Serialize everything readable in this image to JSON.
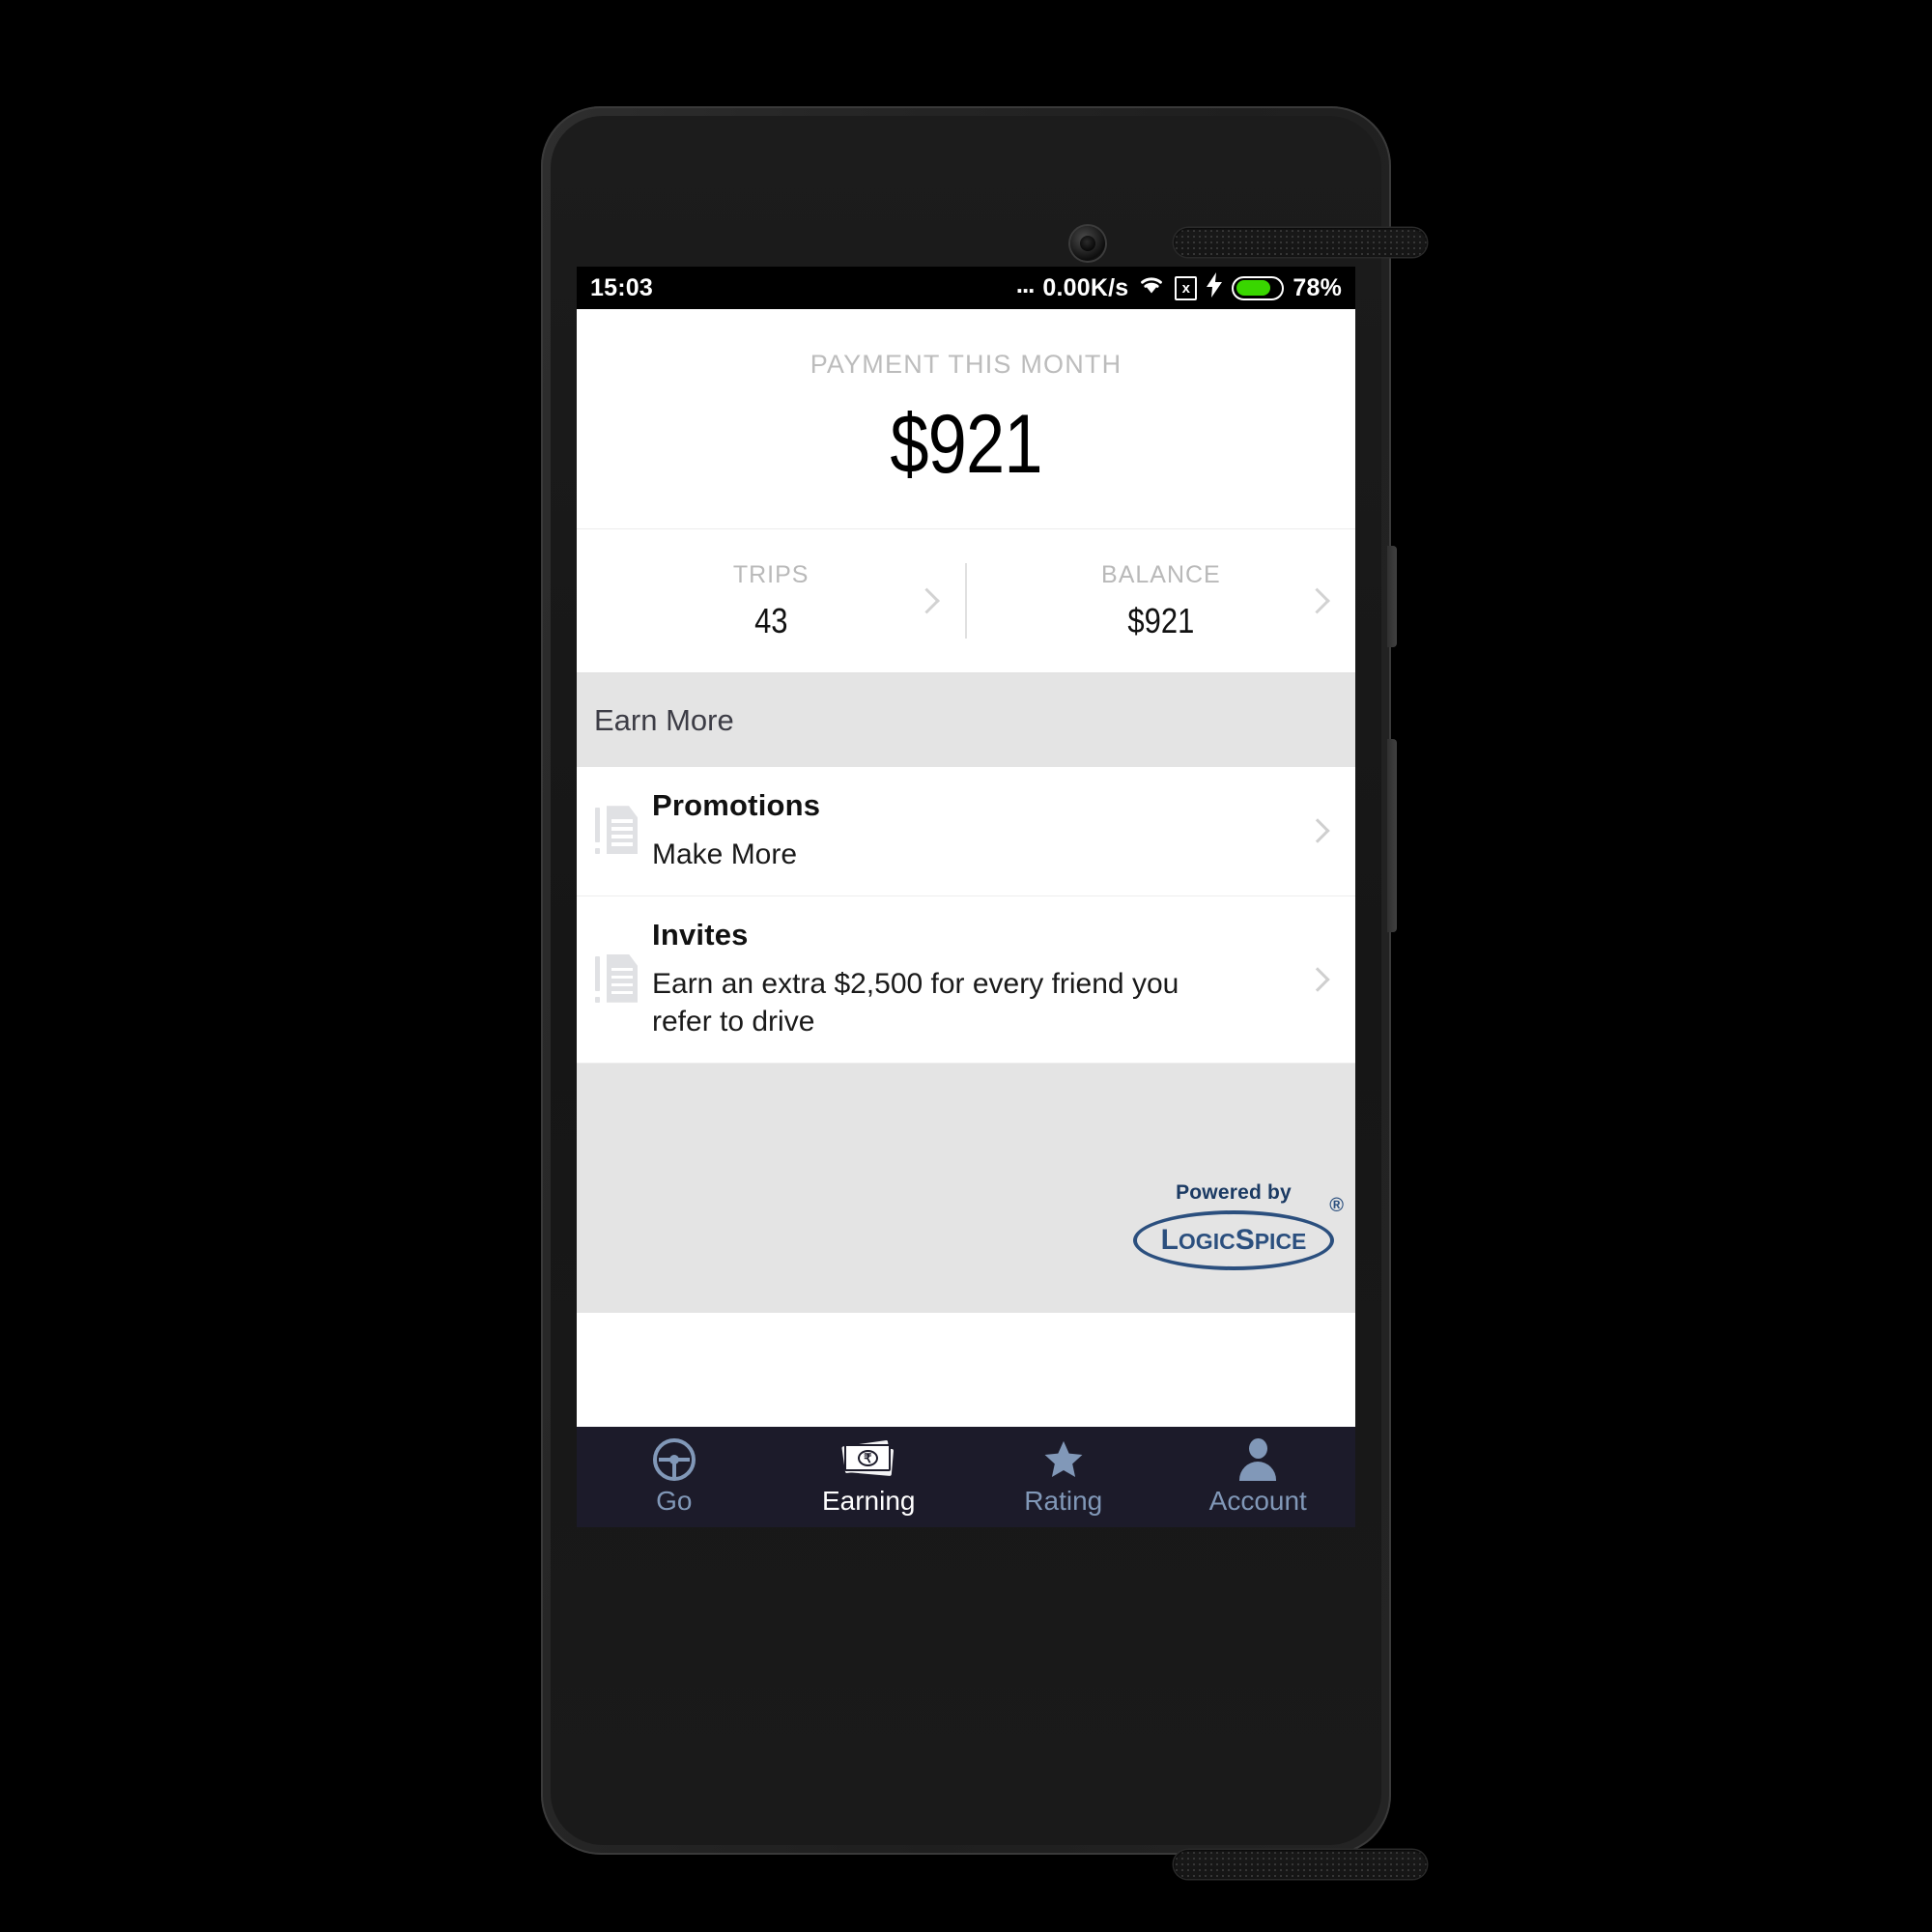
{
  "status_bar": {
    "time": "15:03",
    "dots": "...",
    "network_speed": "0.00K/s",
    "wifi_icon": "wifi-icon",
    "sim_icon": "sim-x-icon",
    "sim_glyph": "x",
    "charging_icon": "lightning-bolt-icon",
    "battery_icon": "battery-icon",
    "battery_percent": "78%",
    "battery_level": 78,
    "battery_color": "#39d600"
  },
  "payment": {
    "label": "PAYMENT THIS MONTH",
    "amount": "$921"
  },
  "stats": [
    {
      "label": "TRIPS",
      "value": "43",
      "chevron": "chevron-right-icon"
    },
    {
      "label": "BALANCE",
      "value": "$921",
      "chevron": "chevron-right-icon"
    }
  ],
  "section": {
    "title": "Earn More"
  },
  "list": [
    {
      "icon": "document-alert-icon",
      "title": "Promotions",
      "subtitle": "Make More",
      "chevron": "chevron-right-icon"
    },
    {
      "icon": "document-alert-icon",
      "title": "Invites",
      "subtitle": "Earn an extra $2,500 for every friend you refer to drive",
      "chevron": "chevron-right-icon"
    }
  ],
  "footer": {
    "powered_by": "Powered by",
    "brand_logic": "L",
    "brand_logic_rest": "OGIC",
    "brand_spice": "S",
    "brand_spice_rest": "PICE",
    "registered": "®"
  },
  "nav": [
    {
      "label": "Go",
      "icon": "steering-wheel-icon",
      "active": false
    },
    {
      "label": "Earning",
      "icon": "banknotes-icon",
      "active": true
    },
    {
      "label": "Rating",
      "icon": "star-icon",
      "active": false
    },
    {
      "label": "Account",
      "icon": "person-icon",
      "active": false
    }
  ],
  "colors": {
    "nav_background": "#1c1b2a",
    "nav_inactive": "#8198b8",
    "nav_active": "#ffffff",
    "section_background": "#e4e4e4",
    "brand_blue": "#2b4f7e"
  },
  "currency_symbol": "₹"
}
